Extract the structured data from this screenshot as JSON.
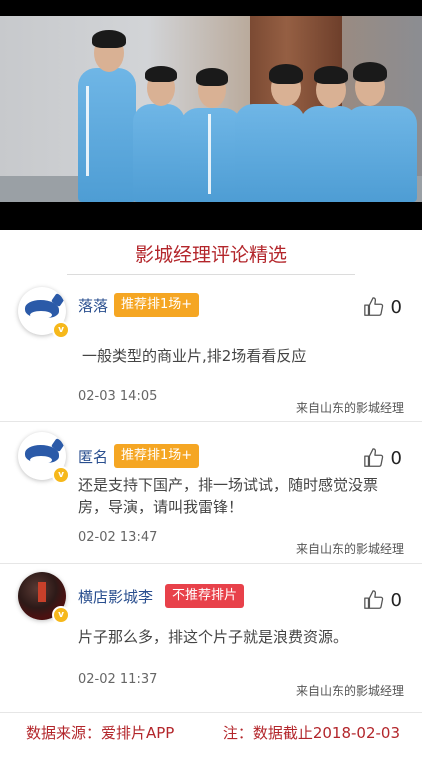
{
  "section_title": "影城经理评论精选",
  "comments": [
    {
      "user": "落落",
      "tag": "推荐排1场+",
      "tag_color": "#f5a623",
      "likes": "0",
      "text": "一般类型的商业片,排2场看看反应",
      "time": "02-03 14:05",
      "source": "来自山东的影城经理"
    },
    {
      "user": "匿名",
      "tag": "推荐排1场+",
      "tag_color": "#f5a623",
      "likes": "0",
      "text": "还是支持下国产，排一场试试，随时感觉没票房，导演，请叫我雷锋！",
      "time": "02-02 13:47",
      "source": "来自山东的影城经理"
    },
    {
      "user": "横店影城李",
      "tag": "不推荐排片",
      "tag_color": "#e8414a",
      "likes": "0",
      "text": "片子那么多，排这个片子就是浪费资源。",
      "time": "02-02 11:37",
      "source": "来自山东的影城经理"
    }
  ],
  "footer": {
    "data_source": "数据来源：爱排片APP",
    "note": "注：数据截止2018-02-03"
  },
  "colors": {
    "title_red": "#b3262b",
    "username_blue": "#2a4f8f",
    "badge_gold": "#f6b81b"
  },
  "icons": {
    "like": "thumbs-up-icon",
    "verified": "verified-badge-icon"
  }
}
